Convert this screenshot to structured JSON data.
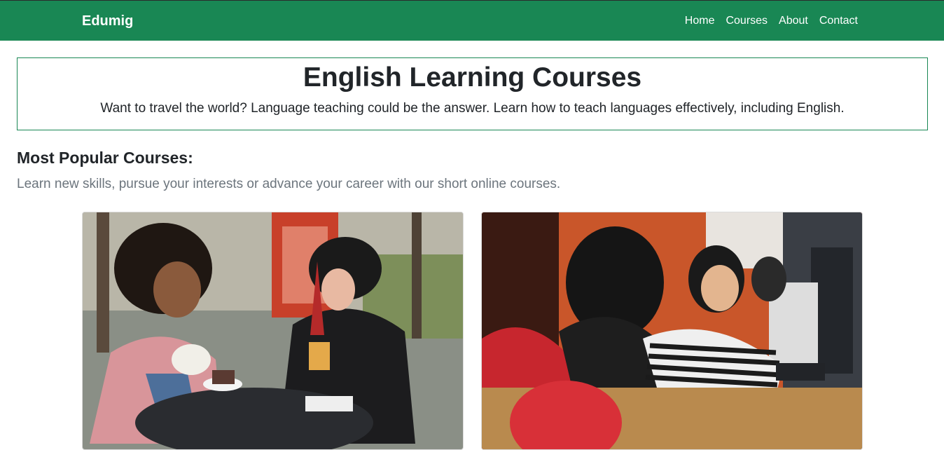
{
  "navbar": {
    "brand": "Edumig",
    "links": [
      "Home",
      "Courses",
      "About",
      "Contact"
    ],
    "color": "#198754"
  },
  "hero": {
    "title": "English Learning Courses",
    "subtitle": "Want to travel the world? Language teaching could be the answer. Learn how to teach languages effectively, including English."
  },
  "popular": {
    "title": "Most Popular Courses:",
    "subtitle": "Learn new skills, pursue your interests or advance your career with our short online courses."
  },
  "cards": [
    {
      "image": "photo-two-women-cafe"
    },
    {
      "image": "photo-students-computer-lab"
    }
  ]
}
